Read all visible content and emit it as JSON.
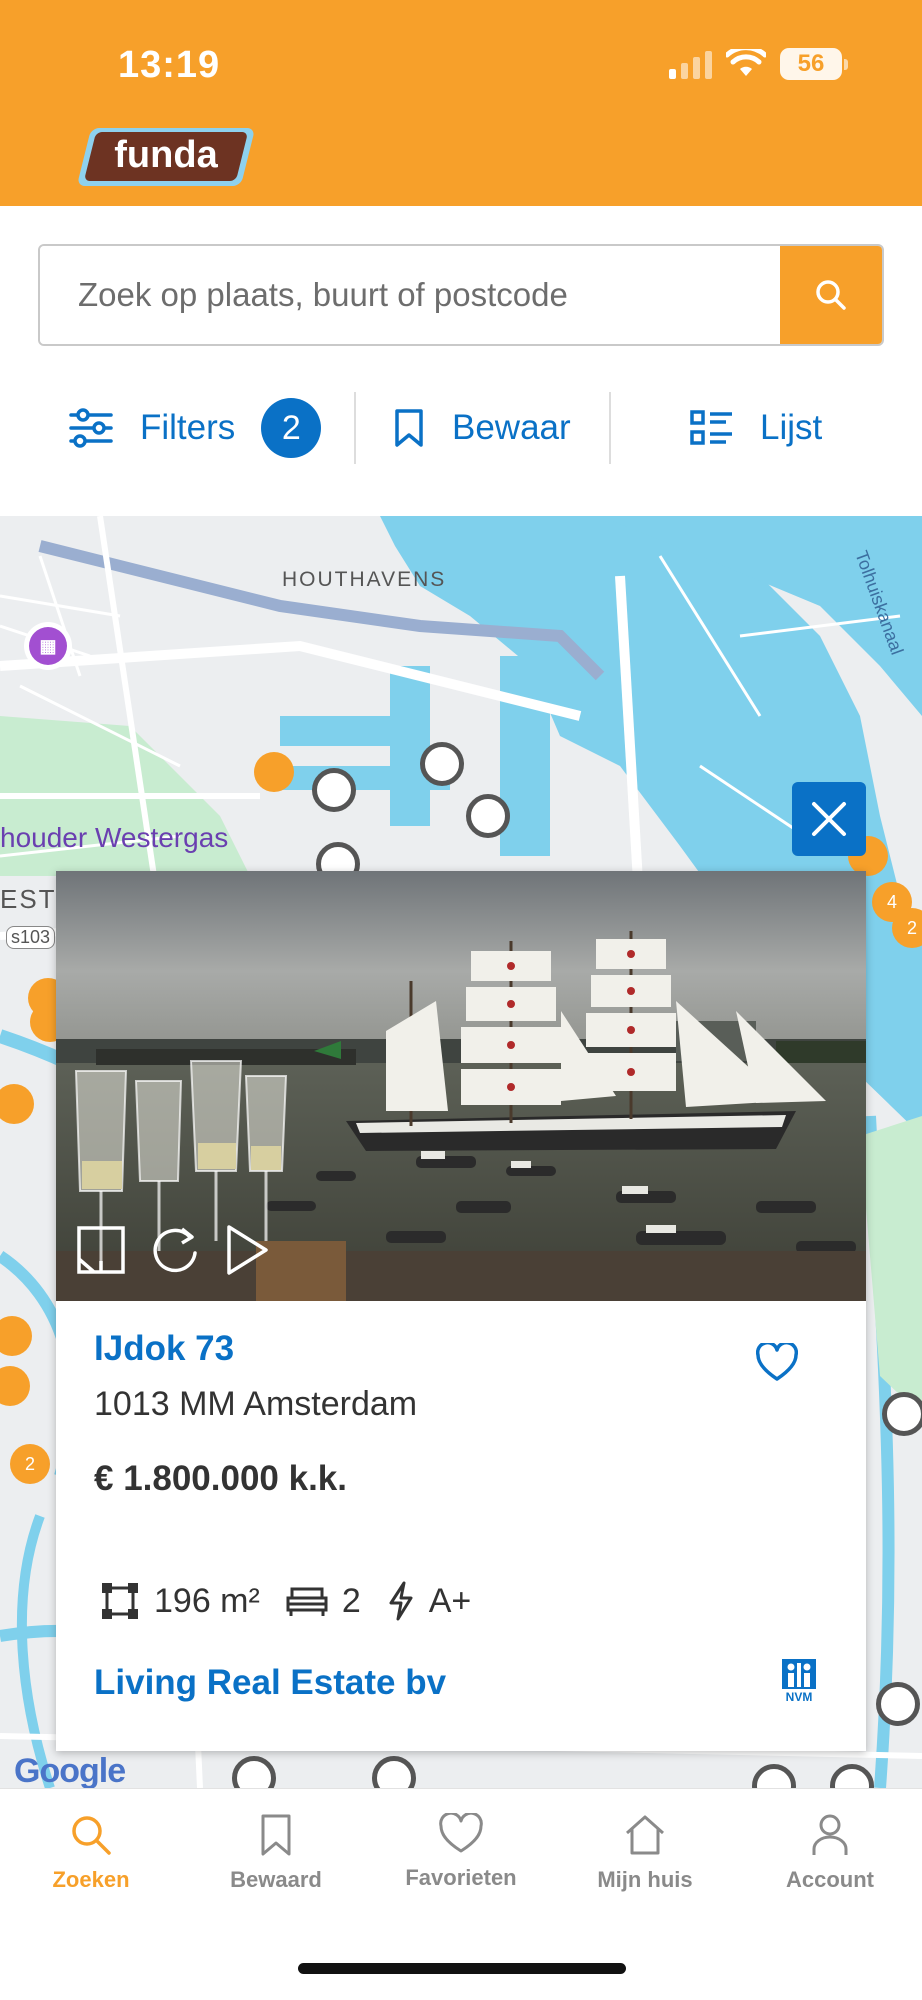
{
  "status_bar": {
    "time": "13:19",
    "battery": "56"
  },
  "header": {
    "logo_text": "funda"
  },
  "search": {
    "placeholder": "Zoek op plaats, buurt of postcode"
  },
  "toolbar": {
    "filters_label": "Filters",
    "filters_count": "2",
    "save_label": "Bewaar",
    "list_label": "Lijst"
  },
  "map": {
    "labels": {
      "houthavens": "HOUTHAVENS",
      "westergas": "houder Westergas",
      "west": "EST",
      "road": "s103",
      "canal": "Tolhuiskanaal"
    },
    "cluster_counts": [
      "4",
      "2",
      "2"
    ],
    "attribution": "Google"
  },
  "listing": {
    "street": "IJdok 73",
    "postcode_city": "1013 MM Amsterdam",
    "price": "€ 1.800.000 k.k.",
    "area": "196 m²",
    "bedrooms": "2",
    "energy_label": "A+",
    "agent": "Living Real Estate bv",
    "agent_badge": "NVM"
  },
  "bottom_nav": {
    "items": [
      {
        "label": "Zoeken",
        "icon": "search-icon",
        "active": true
      },
      {
        "label": "Bewaard",
        "icon": "bookmark-icon",
        "active": false
      },
      {
        "label": "Favorieten",
        "icon": "heart-icon",
        "active": false
      },
      {
        "label": "Mijn huis",
        "icon": "house-icon",
        "active": false
      },
      {
        "label": "Account",
        "icon": "person-icon",
        "active": false
      }
    ]
  },
  "colors": {
    "brand_orange": "#f7a02a",
    "link_blue": "#0a71c6",
    "water": "#7fd0ec"
  }
}
